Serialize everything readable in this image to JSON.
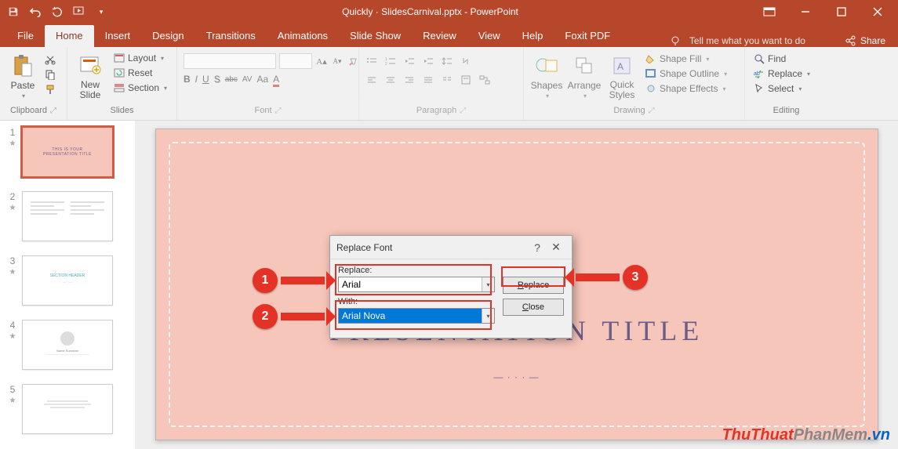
{
  "app": {
    "title": "Quickly · SlidesCarnival.pptx  -  PowerPoint"
  },
  "qat": {
    "save": "Save",
    "undo": "Undo",
    "redo": "Redo",
    "start": "Start From Beginning"
  },
  "window": {
    "ribbon_opts": "Ribbon Display Options",
    "min": "Minimize",
    "max": "Restore",
    "close": "Close"
  },
  "tabs": {
    "file": "File",
    "home": "Home",
    "insert": "Insert",
    "design": "Design",
    "transitions": "Transitions",
    "animations": "Animations",
    "slideshow": "Slide Show",
    "review": "Review",
    "view": "View",
    "help": "Help",
    "foxit": "Foxit PDF",
    "tell_me": "Tell me what you want to do",
    "share": "Share"
  },
  "ribbon": {
    "clipboard": {
      "label": "Clipboard",
      "paste": "Paste",
      "cut": "Cut",
      "copy": "Copy",
      "fp": "Format Painter"
    },
    "slides": {
      "label": "Slides",
      "new_slide": "New\nSlide",
      "layout": "Layout",
      "reset": "Reset",
      "section": "Section"
    },
    "font": {
      "label": "Font",
      "bold": "B",
      "italic": "I",
      "underline": "U",
      "shadow": "S",
      "strike": "abc",
      "spacing": "AV",
      "case": "Aa",
      "clear": "A"
    },
    "paragraph": {
      "label": "Paragraph"
    },
    "drawing": {
      "label": "Drawing",
      "shapes": "Shapes",
      "arrange": "Arrange",
      "quick": "Quick\nStyles",
      "fill": "Shape Fill",
      "outline": "Shape Outline",
      "effects": "Shape Effects"
    },
    "editing": {
      "label": "Editing",
      "find": "Find",
      "replace": "Replace",
      "select": "Select"
    }
  },
  "thumbs": {
    "nums": [
      "1",
      "2",
      "3",
      "4",
      "5"
    ],
    "t1a": "THIS IS YOUR",
    "t1b": "PRESENTATION TITLE"
  },
  "slide": {
    "title": "PRESENTATION TITLE",
    "subtitle": "— · · · —"
  },
  "dialog": {
    "title": "Replace Font",
    "replace_label": "Replace:",
    "replace_value": "Arial",
    "with_label": "With:",
    "with_value": "Arial Nova",
    "btn_replace": "Replace",
    "btn_replace_u": "R",
    "btn_close": "Close",
    "btn_close_u": "C",
    "help": "?",
    "x": "✕"
  },
  "callouts": {
    "c1": "1",
    "c2": "2",
    "c3": "3"
  },
  "watermark": {
    "a": "ThuThuat",
    "b": "PhanMem",
    "c": ".vn"
  }
}
